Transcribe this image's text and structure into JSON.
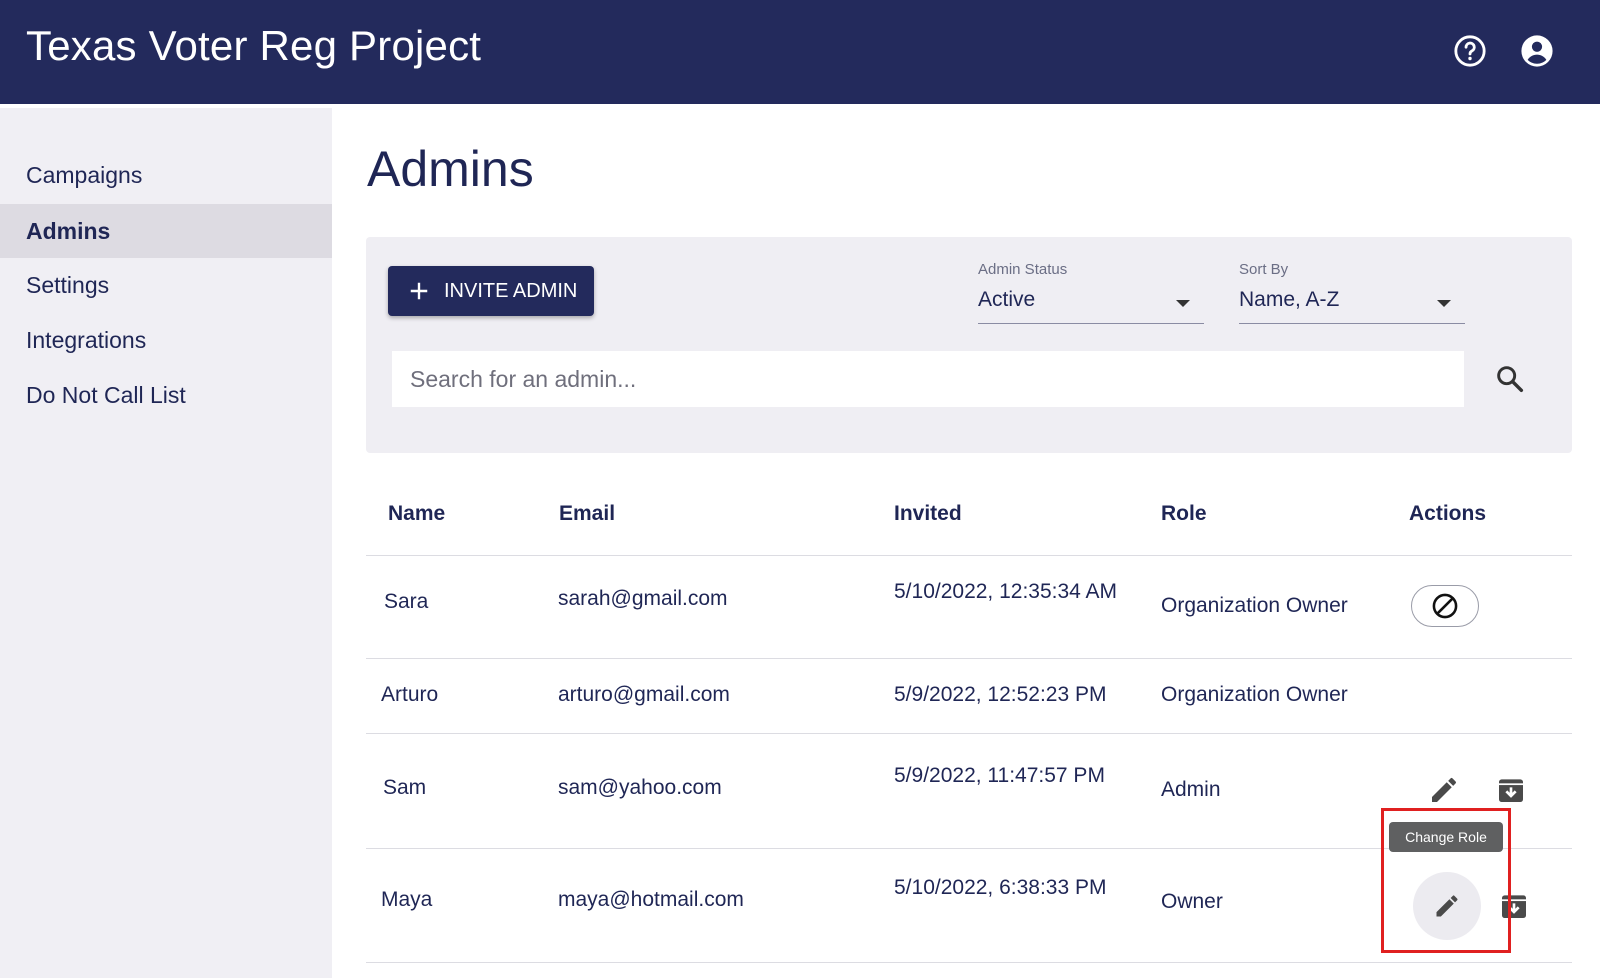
{
  "header": {
    "title": "Texas Voter Reg Project",
    "help_icon": "help-circle-icon",
    "account_icon": "account-circle-icon"
  },
  "sidebar": {
    "items": [
      {
        "label": "Campaigns",
        "active": false
      },
      {
        "label": "Admins",
        "active": true
      },
      {
        "label": "Settings",
        "active": false
      },
      {
        "label": "Integrations",
        "active": false
      },
      {
        "label": "Do Not Call List",
        "active": false
      }
    ]
  },
  "page": {
    "title": "Admins"
  },
  "toolbar": {
    "invite_label": "INVITE ADMIN",
    "status_filter": {
      "label": "Admin Status",
      "value": "Active"
    },
    "sort": {
      "label": "Sort By",
      "value": "Name, A-Z"
    },
    "search_placeholder": "Search for an admin..."
  },
  "table": {
    "columns": [
      "Name",
      "Email",
      "Invited",
      "Role",
      "Actions"
    ],
    "rows": [
      {
        "name": "Sara",
        "email": "sarah@gmail.com",
        "invited": "5/10/2022, 12:35:34 AM",
        "role": "Organization Owner",
        "actions": [
          "block"
        ]
      },
      {
        "name": "Arturo",
        "email": "arturo@gmail.com",
        "invited": "5/9/2022, 12:52:23 PM",
        "role": "Organization Owner",
        "actions": []
      },
      {
        "name": "Sam",
        "email": "sam@yahoo.com",
        "invited": "5/9/2022, 11:47:57 PM",
        "role": "Admin",
        "actions": [
          "edit",
          "archive"
        ]
      },
      {
        "name": "Maya",
        "email": "maya@hotmail.com",
        "invited": "5/10/2022, 6:38:33 PM",
        "role": "Owner",
        "actions": [
          "edit",
          "archive"
        ]
      }
    ]
  },
  "tooltip": {
    "text": "Change Role"
  },
  "colors": {
    "header_bg": "#232a5c",
    "text": "#1f2655",
    "sidebar_bg": "#f0eff4",
    "sidebar_active": "#dddbe2",
    "highlight": "#e02020"
  }
}
